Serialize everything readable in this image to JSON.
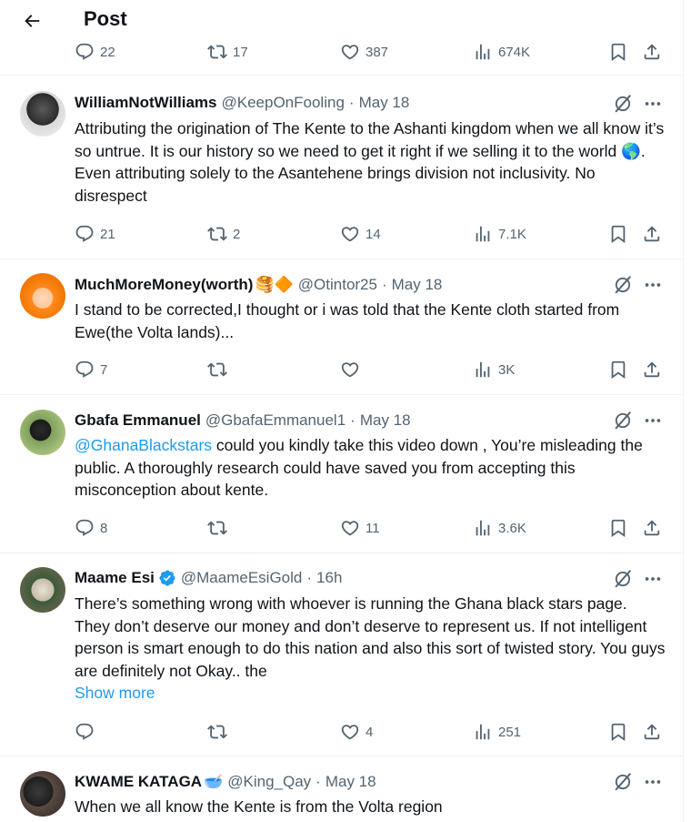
{
  "header": {
    "title": "Post"
  },
  "peek": {
    "replies": "22",
    "reposts": "17",
    "likes": "387",
    "views": "674K"
  },
  "tweets": [
    {
      "name": "WilliamNotWilliams",
      "handle": "@KeepOnFooling",
      "date": "May 18",
      "text": "Attributing the origination of The Kente to the Ashanti kingdom when we all know it’s so untrue. It is our history so we need to get it right if we selling it to the world 🌎. Even attributing solely to the Asantehene brings division not inclusivity. No disrespect",
      "replies": "21",
      "reposts": "2",
      "likes": "14",
      "views": "7.1K"
    },
    {
      "name": "MuchMoreMoney(worth)",
      "name_emoji": "🥞🔶",
      "handle": "@Otintor25",
      "date": "May 18",
      "text": "I stand to be corrected,I thought or i was told that the Kente cloth started from Ewe(the Volta lands)...",
      "replies": "7",
      "reposts": "",
      "likes": "",
      "views": "3K"
    },
    {
      "name": "Gbafa Emmanuel",
      "handle": "@GbafaEmmanuel1",
      "date": "May 18",
      "mention": "@GhanaBlackstars",
      "text": "  could you kindly take this video down , You’re misleading the public. A thoroughly research could  have saved you from accepting this misconception about kente.",
      "replies": "8",
      "reposts": "",
      "likes": "11",
      "views": "3.6K"
    },
    {
      "name": "Maame Esi",
      "handle": "@MaameEsiGold",
      "date": "16h",
      "text": "There’s something wrong with whoever is running the Ghana black stars page. They don’t deserve our money and don’t deserve to represent us. If not intelligent person is smart enough to do this nation and also this sort of twisted story. You guys are definitely not Okay.. the",
      "show_more": "Show more",
      "replies": "",
      "reposts": "",
      "likes": "4",
      "views": "251"
    },
    {
      "name": "KWAME KATAGA",
      "name_emoji": "🥣",
      "handle": "@King_Qay",
      "date": "May 18",
      "text": "When we all know the Kente is from the Volta region"
    }
  ],
  "colors": {
    "accent": "#1d9bf0",
    "muted": "#536471",
    "verified": "#1d9bf0"
  }
}
